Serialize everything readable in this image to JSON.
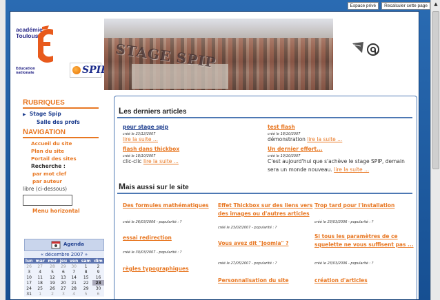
{
  "toolbar": {
    "private_space": "Espace privé",
    "recalc": "Recalculer cette page"
  },
  "logo": {
    "academie": "académie",
    "toulouse": "Toulouse",
    "education1": "Education",
    "education2": "nationale",
    "spip": "SPIP"
  },
  "banner": {
    "title": "STAGE SPIP"
  },
  "nav": {
    "rubriques_cap": "R",
    "rubriques": "UBRIQUES",
    "rubrique_items": [
      "Stage Spip",
      "Salle des profs"
    ],
    "navigation_cap": "N",
    "navigation": "AVIGATION",
    "links": [
      "Accueil du site",
      "Plan du site",
      "Portail des sites"
    ],
    "recherche": "Recherche :",
    "search_links": [
      "par mot clef",
      "par auteur"
    ],
    "libre": "libre (ci-dessous)",
    "menu_horizontal": "Menu horizontal"
  },
  "agenda": {
    "title": "Agenda",
    "month": "« décembre 2007 »",
    "days": [
      "lun",
      "mar",
      "mer",
      "jeu",
      "ven",
      "sam",
      "dim"
    ],
    "weeks": [
      [
        "26",
        "27",
        "28",
        "29",
        "30",
        "1",
        "2"
      ],
      [
        "3",
        "4",
        "5",
        "6",
        "7",
        "8",
        "9"
      ],
      [
        "10",
        "11",
        "12",
        "13",
        "14",
        "15",
        "16"
      ],
      [
        "17",
        "18",
        "19",
        "20",
        "21",
        "22",
        "23"
      ],
      [
        "24",
        "25",
        "26",
        "27",
        "28",
        "29",
        "30"
      ],
      [
        "31",
        "1",
        "2",
        "3",
        "4",
        "5",
        "6"
      ]
    ]
  },
  "latest": {
    "title_cap": "L",
    "title": "es derniers articles",
    "more": "lire la suite ...",
    "left": [
      {
        "title": "pour stage spip",
        "date": "créé le 23/12/2007",
        "text": ""
      },
      {
        "title": "flash dans thickbox",
        "date": "créé le 18/10/2007",
        "text": "clic-clic"
      }
    ],
    "right": [
      {
        "title": "test flash",
        "date": "créé le 18/10/2007",
        "text": "démonstration"
      },
      {
        "title": "Un dernier effort...",
        "date": "créé le 10/10/2007",
        "text1": "C'est aujourd'hui que s'achève le stage SPIP, demain",
        "text2": "sera un monde nouveau."
      }
    ]
  },
  "also": {
    "title_cap": "M",
    "title": "ais aussi sur le site",
    "col1": [
      {
        "title": "Des formules mathématiques",
        "meta": "créé le 26/03/2006 - popularité : ?"
      },
      {
        "title": "essai redirection",
        "meta": "créé le 30/03/2007 - popularité : ?"
      },
      {
        "title": "règles typographiques",
        "meta": ""
      }
    ],
    "col2": [
      {
        "title1": "Effet Thickbox sur des liens vers",
        "title2": "des images ou d'autres articles",
        "meta": "créé le 23/02/2007 - popularité : ?"
      },
      {
        "title1": "Vous avez dit \"Joomla\" ?",
        "title2": "",
        "meta": "créé le 27/05/2007 - popularité : ?"
      },
      {
        "title1": "Personnalisation du site",
        "title2": "",
        "meta": ""
      }
    ],
    "col3": [
      {
        "title1": "Trop tard pour l'installation",
        "title2": "",
        "meta": "créé le 23/03/2006 - popularité : ?"
      },
      {
        "title1": "Si tous les paramètres de ce",
        "title2": "squelette ne vous suffisent pas ...",
        "meta": "créé le 23/03/2006 - popularité : ?"
      },
      {
        "title1": "création d'articles",
        "title2": "",
        "meta": ""
      }
    ]
  }
}
